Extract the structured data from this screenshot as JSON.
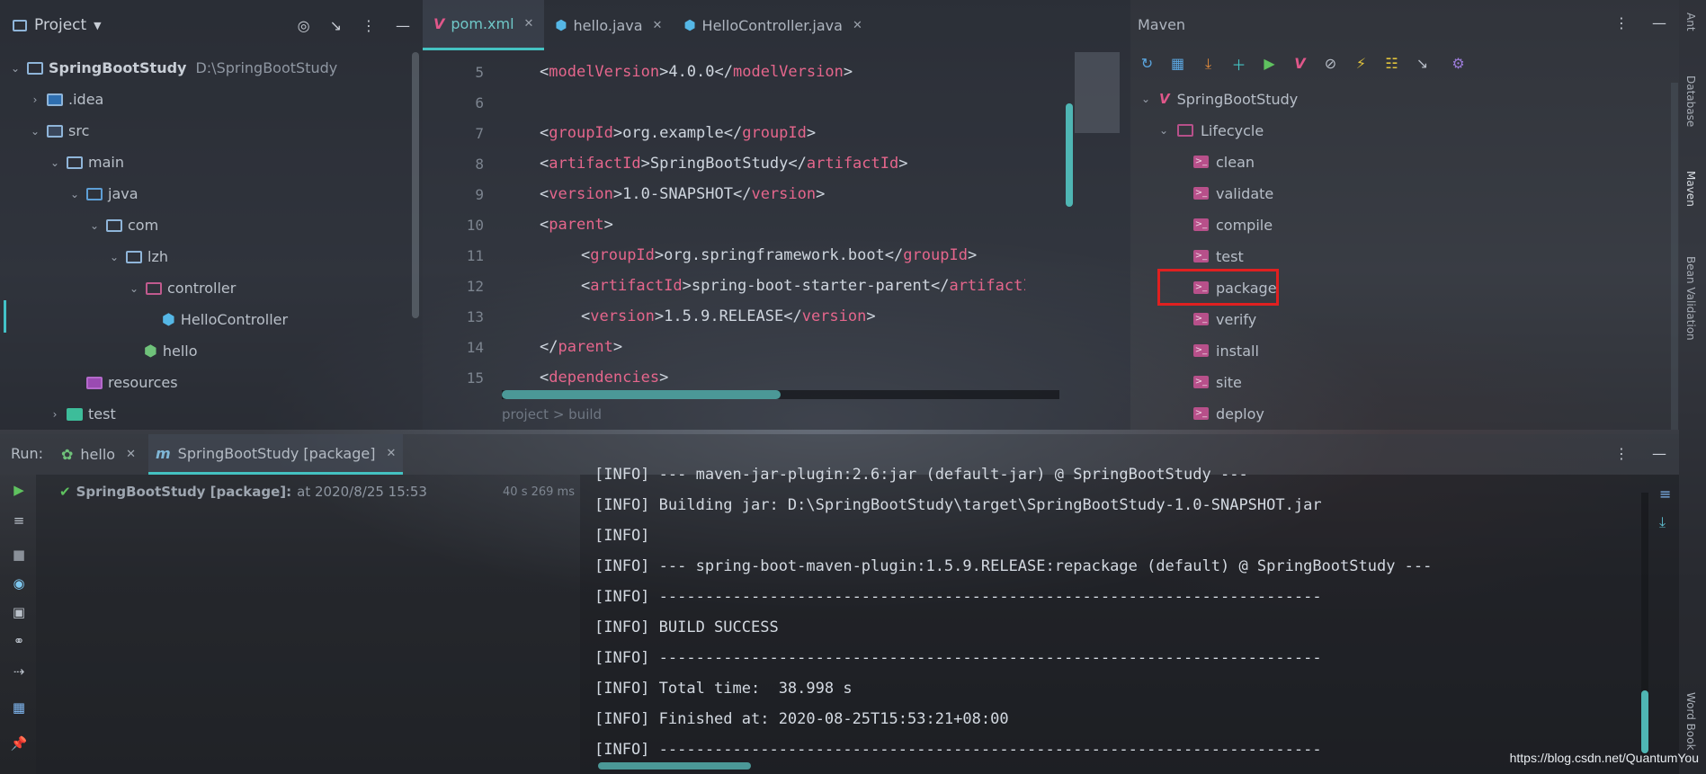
{
  "project": {
    "title": "Project",
    "tree": [
      {
        "label": "SpringBootStudy",
        "extra": "D:\\SpringBootStudy",
        "icon": "folder-module-icon"
      },
      {
        "label": ".idea",
        "icon": "folder-idea-icon"
      },
      {
        "label": "src",
        "icon": "folder-src-icon"
      },
      {
        "label": "main",
        "icon": "folder-icon"
      },
      {
        "label": "java",
        "icon": "folder-source-icon"
      },
      {
        "label": "com",
        "icon": "folder-icon"
      },
      {
        "label": "lzh",
        "icon": "folder-icon"
      },
      {
        "label": "controller",
        "icon": "package-icon"
      },
      {
        "label": "HelloController",
        "icon": "class-icon"
      },
      {
        "label": "hello",
        "icon": "spring-boot-class-icon"
      },
      {
        "label": "resources",
        "icon": "resources-folder-icon"
      },
      {
        "label": "test",
        "icon": "test-folder-icon"
      }
    ]
  },
  "editor": {
    "tabs": [
      {
        "label": "pom.xml",
        "icon": "maven-icon"
      },
      {
        "label": "hello.java",
        "icon": "spring-class-icon"
      },
      {
        "label": "HelloController.java",
        "icon": "class-icon"
      }
    ],
    "lines": [
      {
        "n": "5",
        "text": "<modelVersion>4.0.0</modelVersion>"
      },
      {
        "n": "6",
        "text": ""
      },
      {
        "n": "7",
        "text": "<groupId>org.example</groupId>"
      },
      {
        "n": "8",
        "text": "<artifactId>SpringBootStudy</artifactId>"
      },
      {
        "n": "9",
        "text": "<version>1.0-SNAPSHOT</version>"
      },
      {
        "n": "10",
        "text": "<parent>"
      },
      {
        "n": "11",
        "text": "<groupId>org.springframework.boot</groupId>"
      },
      {
        "n": "12",
        "text": "<artifactId>spring-boot-starter-parent</artifactId"
      },
      {
        "n": "13",
        "text": "<version>1.5.9.RELEASE</version>"
      },
      {
        "n": "14",
        "text": "</parent>"
      },
      {
        "n": "15",
        "text": "<dependencies>"
      }
    ],
    "breadcrumbs": "project  >  build"
  },
  "maven": {
    "title": "Maven",
    "root": "SpringBootStudy",
    "lifecycle": "Lifecycle",
    "goals": [
      "clean",
      "validate",
      "compile",
      "test",
      "package",
      "verify",
      "install",
      "site",
      "deploy"
    ],
    "highlighted_goal": "package"
  },
  "side_strip": [
    "Ant",
    "Database",
    "Maven",
    "Bean Validation",
    "Word Book"
  ],
  "run": {
    "label": "Run:",
    "tabs": [
      {
        "label": "hello"
      },
      {
        "label": "SpringBootStudy [package]"
      }
    ],
    "tree_item": "SpringBootStudy [package]:",
    "tree_item_time": "at 2020/8/25 15:53",
    "duration": "40 s 269 ms"
  },
  "console": {
    "lines": [
      "[INFO] --- maven-jar-plugin:2.6:jar (default-jar) @ SpringBootStudy ---",
      "[INFO] Building jar: D:\\SpringBootStudy\\target\\SpringBootStudy-1.0-SNAPSHOT.jar",
      "[INFO]",
      "[INFO] --- spring-boot-maven-plugin:1.5.9.RELEASE:repackage (default) @ SpringBootStudy ---",
      "[INFO] ------------------------------------------------------------------------",
      "[INFO] BUILD SUCCESS",
      "[INFO] ------------------------------------------------------------------------",
      "[INFO] Total time:  38.998 s",
      "[INFO] Finished at: 2020-08-25T15:53:21+08:00",
      "[INFO] ------------------------------------------------------------------------"
    ]
  },
  "watermark": "https://blog.csdn.net/QuantumYou",
  "colors": {
    "accent": "#44c2c2",
    "tag": "#e5668c",
    "highlight_box": "#e02020",
    "maven_goal": "#b7508a"
  }
}
